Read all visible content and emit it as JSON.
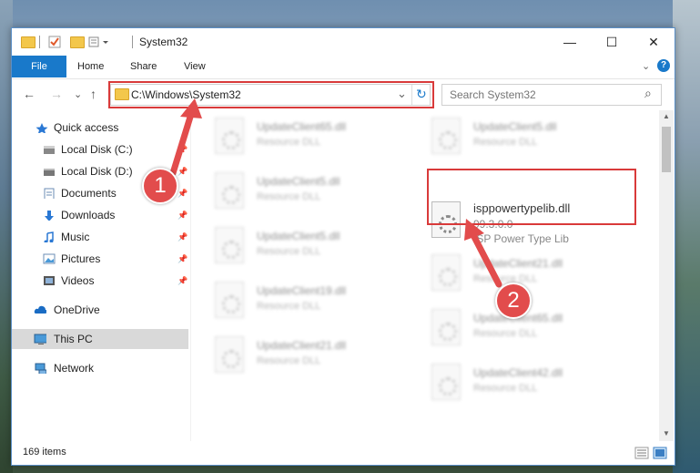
{
  "window": {
    "title": "System32",
    "minimize": "—",
    "maximize": "☐",
    "close": "✕"
  },
  "ribbon": {
    "tabs": [
      "File",
      "Home",
      "Share",
      "View"
    ],
    "expand": "⌄",
    "help": "?"
  },
  "address": {
    "path": "C:\\Windows\\System32",
    "dropdown": "⌄",
    "refresh": "↻",
    "back": "←",
    "forward": "→",
    "recent": "⌄",
    "up": "↑"
  },
  "search": {
    "placeholder": "Search System32",
    "icon": "⌕"
  },
  "nav": {
    "items": [
      {
        "label": "Quick access",
        "icon": "star-icon"
      },
      {
        "label": "Local Disk (C:)",
        "icon": "drive-icon",
        "pinned": true
      },
      {
        "label": "Local Disk (D:)",
        "icon": "drive-icon",
        "pinned": true
      },
      {
        "label": "Documents",
        "icon": "documents-icon",
        "pinned": true
      },
      {
        "label": "Downloads",
        "icon": "download-icon",
        "pinned": true
      },
      {
        "label": "Music",
        "icon": "music-icon",
        "pinned": true
      },
      {
        "label": "Pictures",
        "icon": "pictures-icon",
        "pinned": true
      },
      {
        "label": "Videos",
        "icon": "videos-icon",
        "pinned": true
      },
      {
        "label": "OneDrive",
        "icon": "cloud-icon"
      },
      {
        "label": "This PC",
        "icon": "computer-icon",
        "selected": true
      },
      {
        "label": "Network",
        "icon": "network-icon"
      }
    ]
  },
  "files": {
    "left": [
      {
        "name": "UpdateClient65.dll",
        "desc": "Resource DLL"
      },
      {
        "name": "UpdateClient5.dll",
        "desc": "Resource DLL"
      },
      {
        "name": "UpdateClient5.dll",
        "desc": "Resource DLL"
      },
      {
        "name": "UpdateClient19.dll",
        "desc": "Resource DLL"
      },
      {
        "name": "UpdateClient21.dll",
        "desc": "Resource DLL"
      }
    ],
    "right": [
      {
        "name": "UpdateClient5.dll",
        "desc": "Resource DLL"
      },
      {
        "name": "isppowertypelib.dll",
        "version": "99.3.0.0",
        "desc": "ISP Power Type Lib"
      },
      {
        "name": "UpdateClient21.dll",
        "desc": "Resource DLL"
      },
      {
        "name": "UpdateClient65.dll",
        "desc": "Resource DLL"
      },
      {
        "name": "UpdateClient42.dll",
        "desc": "Resource DLL"
      }
    ]
  },
  "status": {
    "count": "169 items"
  },
  "annotations": {
    "step1": "1",
    "step2": "2",
    "color": "#e24c4c"
  }
}
